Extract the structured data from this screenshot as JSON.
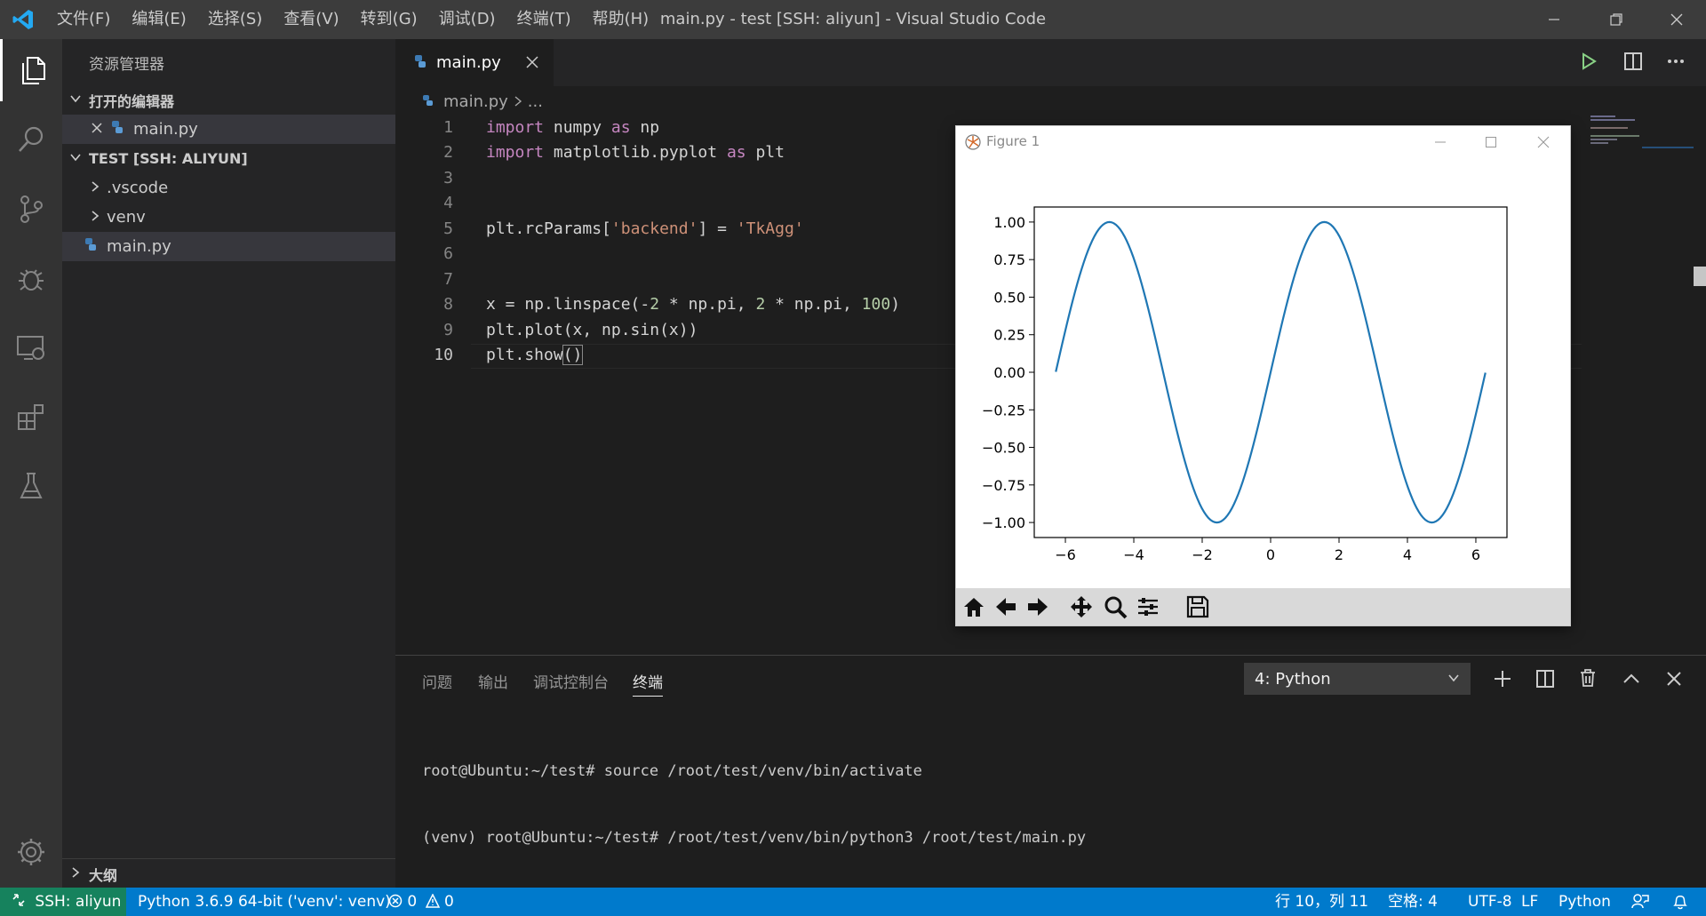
{
  "titlebar": {
    "menus": [
      "文件(F)",
      "编辑(E)",
      "选择(S)",
      "查看(V)",
      "转到(G)",
      "调试(D)",
      "终端(T)",
      "帮助(H)"
    ],
    "title": "main.py - test [SSH: aliyun] - Visual Studio Code"
  },
  "sidebar": {
    "header": "资源管理器",
    "open_editors_label": "打开的编辑器",
    "open_editor_file": "main.py",
    "workspace_label": "TEST [SSH: ALIYUN]",
    "tree": [
      ".vscode",
      "venv",
      "main.py"
    ],
    "outline_label": "大纲"
  },
  "editor": {
    "tab_label": "main.py",
    "breadcrumb_file": "main.py",
    "breadcrumb_rest": "...",
    "line_numbers": [
      "1",
      "2",
      "3",
      "4",
      "5",
      "6",
      "7",
      "8",
      "9",
      "10"
    ]
  },
  "figure": {
    "title": "Figure 1",
    "toolbar_icons": [
      "home-icon",
      "back-arrow-icon",
      "forward-arrow-icon",
      "pan-icon",
      "zoom-icon",
      "configure-subplots-icon",
      "save-icon"
    ]
  },
  "chart_data": {
    "type": "line",
    "title": "",
    "xlabel": "",
    "ylabel": "",
    "xlim": [
      -6.91,
      6.91
    ],
    "ylim": [
      -1.1,
      1.1
    ],
    "xticks": [
      -6,
      -4,
      -2,
      0,
      2,
      4,
      6
    ],
    "xtick_labels": [
      "−6",
      "−4",
      "−2",
      "0",
      "2",
      "4",
      "6"
    ],
    "yticks": [
      1.0,
      0.75,
      0.5,
      0.25,
      0.0,
      -0.25,
      -0.5,
      -0.75,
      -1.0
    ],
    "ytick_labels": [
      "1.00",
      "0.75",
      "0.50",
      "0.25",
      "0.00",
      "−0.25",
      "−0.50",
      "−0.75",
      "−1.00"
    ],
    "grid": false,
    "series": [
      {
        "color": "#1f77b4",
        "x": [
          -6.28,
          -5.5,
          -4.71,
          -3.93,
          -3.14,
          -2.36,
          -1.57,
          -0.79,
          0.0,
          0.79,
          1.57,
          2.36,
          3.14,
          3.93,
          4.71,
          5.5,
          6.28
        ],
        "y": [
          0.0,
          0.71,
          1.0,
          0.71,
          0.0,
          -0.71,
          -1.0,
          -0.71,
          0.0,
          0.71,
          1.0,
          0.71,
          0.0,
          -0.71,
          -1.0,
          -0.71,
          0.0
        ]
      }
    ]
  },
  "panel": {
    "tabs": [
      "问题",
      "输出",
      "调试控制台",
      "终端"
    ],
    "active_tab": "终端",
    "terminal_select": "4: Python",
    "terminal_lines": [
      "root@Ubuntu:~/test# source /root/test/venv/bin/activate",
      "(venv) root@Ubuntu:~/test# /root/test/venv/bin/python3 /root/test/main.py"
    ]
  },
  "statusbar": {
    "remote": "SSH: aliyun",
    "interpreter": "Python 3.6.9 64-bit ('venv': venv)",
    "errors": "0",
    "warnings": "0",
    "position": "行 10，列 11",
    "spaces": "空格: 4",
    "encoding": "UTF-8",
    "eol": "LF",
    "language": "Python"
  },
  "colors": {
    "accent": "#007acc",
    "titlebar": "#3c3c3c",
    "activitybar": "#333333",
    "sidebar": "#252526",
    "editor": "#1e1e1e",
    "line_color": "#1f77b4"
  }
}
